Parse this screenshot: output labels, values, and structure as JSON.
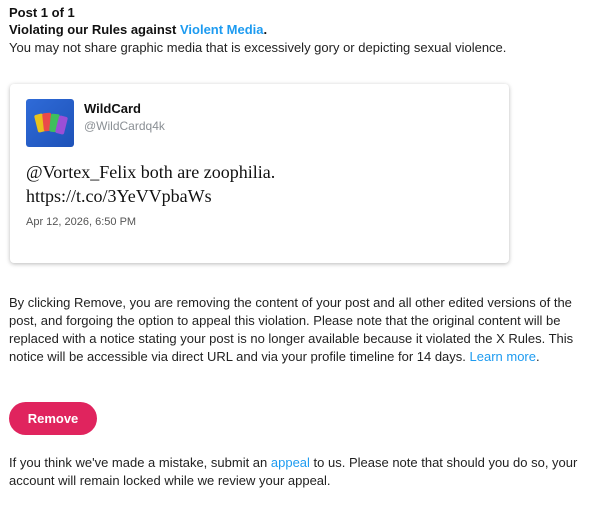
{
  "header": {
    "post_count": "Post 1 of 1",
    "rule_prefix": "Violating our Rules against ",
    "rule_link": "Violent Media",
    "rule_suffix": ".",
    "rule_description": "You may not share graphic media that is excessively gory or depicting sexual violence."
  },
  "tweet": {
    "display_name": "WildCard",
    "handle": "@WildCardq4k",
    "text_line1": "@Vortex_Felix both are zoophilia.",
    "text_line2": "https://t.co/3YeVVpbaWs",
    "timestamp": "Apr 12, 2026, 6:50 PM"
  },
  "consent": {
    "body": "By clicking Remove, you are removing the content of your post and all other edited versions of the post, and forgoing the option to appeal this violation. Please note that the original content will be replaced with a notice stating your post is no longer available because it violated the X Rules. This notice will be accessible via direct URL and via your profile timeline for 14 days. ",
    "learn_more": "Learn more",
    "learn_more_suffix": "."
  },
  "actions": {
    "remove_label": "Remove"
  },
  "appeal": {
    "prefix": "If you think we've made a mistake, submit an ",
    "link": "appeal",
    "suffix": " to us. Please note that should you do so, your account will remain locked while we review your appeal."
  },
  "colors": {
    "link": "#1d9bf0",
    "remove_button": "#e0245e"
  }
}
